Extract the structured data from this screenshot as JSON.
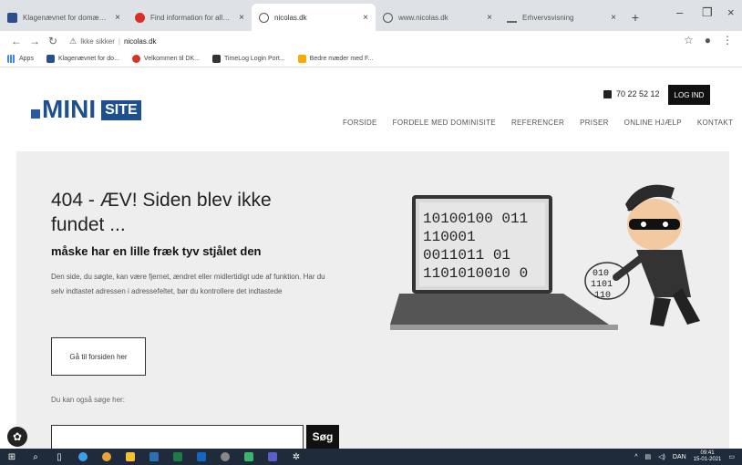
{
  "browser": {
    "tabs": [
      {
        "label": "Klagenævnet for domænenavne",
        "favicon": "blue",
        "active": false
      },
      {
        "label": "Find information for alle dk",
        "favicon": "red",
        "active": false
      },
      {
        "label": "nicolas.dk",
        "favicon": "globe",
        "active": true
      },
      {
        "label": "www.nicolas.dk",
        "favicon": "globe",
        "active": false
      },
      {
        "label": "Erhvervsvisning",
        "favicon": "scale",
        "active": false
      }
    ],
    "address": {
      "security": "Ikke sikker",
      "host": "nicolas.dk"
    },
    "bookmarks": [
      {
        "label": "Apps",
        "icon": "grid"
      },
      {
        "label": "Klagenævnet for do...",
        "icon": "blue"
      },
      {
        "label": "Velkommen til DK...",
        "icon": "red"
      },
      {
        "label": "TimeLog Login Port...",
        "icon": "dark"
      },
      {
        "label": "Bedre mæder med F...",
        "icon": "yellow"
      }
    ]
  },
  "site": {
    "logo": {
      "mini": "MINI",
      "site": "SITE"
    },
    "phone": "70 22 52 12",
    "login_label": "LOG IND",
    "nav": [
      "FORSIDE",
      "FORDELE MED DOMINISITE",
      "REFERENCER",
      "PRISER",
      "ONLINE HJÆLP",
      "KONTAKT"
    ]
  },
  "hero": {
    "title": "404 - ÆV! Siden blev ikke fundet ...",
    "subtitle": "måske har en lille fræk tyv stjålet den",
    "text": "Den side, du søgte, kan være fjernet, ændret eller midlertidigt ude af funktion. Har du selv indtastet adressen i adressefeltet, bør du kontrollere det indtastede",
    "front_button": "Gå til forsiden her",
    "search_label": "Du kan også søge her:",
    "search_button": "Søg",
    "binary_lines": [
      "10100100   011",
      "110001",
      "0011011        01",
      "1101010010   0"
    ]
  },
  "taskbar": {
    "language": "DAN",
    "time": "09:41",
    "date": "15-01-2021"
  },
  "colors": {
    "brand_blue": "#1e4f8f",
    "hero_bg": "#eeeeee",
    "button_dark": "#111111"
  }
}
